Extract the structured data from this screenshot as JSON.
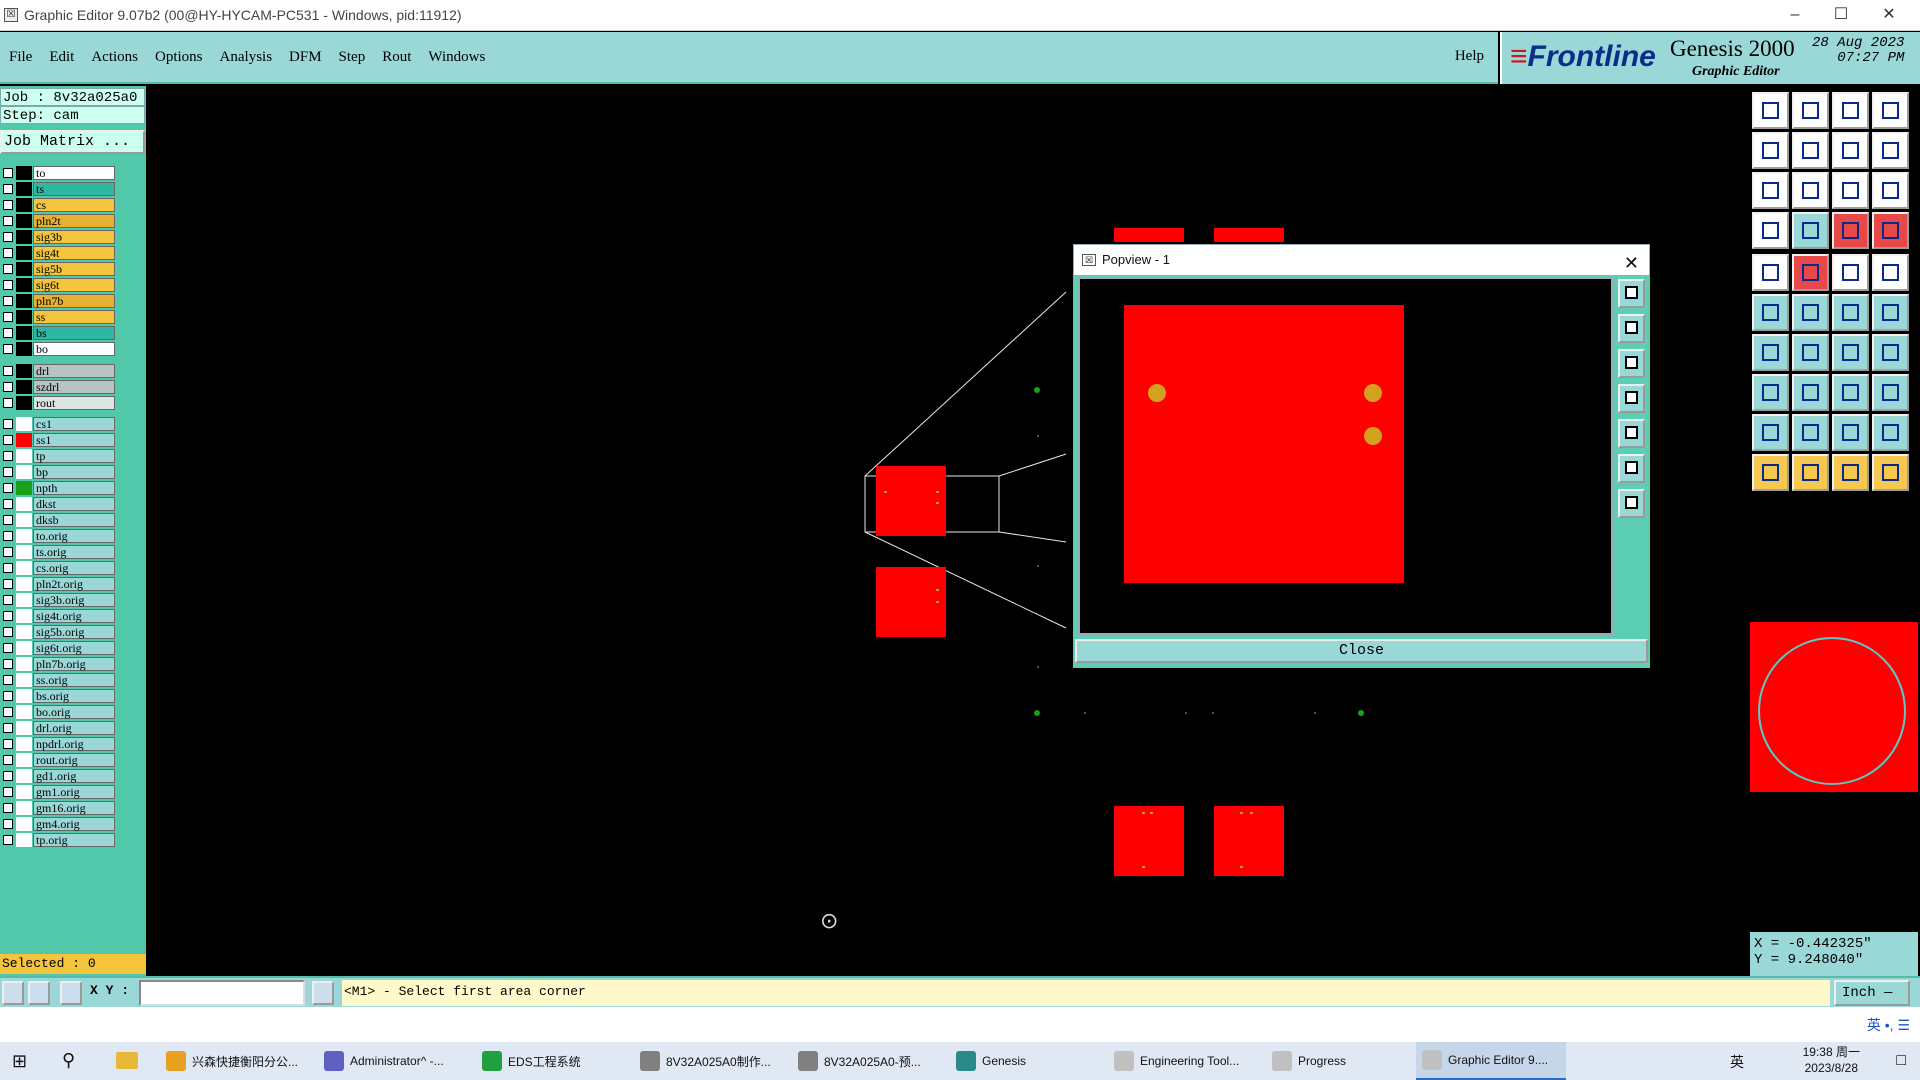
{
  "window": {
    "title": "Graphic Editor 9.07b2 (00@HY-HYCAM-PC531 - Windows, pid:11912)"
  },
  "window_controls": {
    "minimize": "–",
    "maximize": "☐",
    "close": "✕"
  },
  "menu": {
    "items": [
      "File",
      "Edit",
      "Actions",
      "Options",
      "Analysis",
      "DFM",
      "Step",
      "Rout",
      "Windows"
    ],
    "help": "Help"
  },
  "brand": {
    "logo_prefix": "Frontline",
    "product": "Genesis 2000",
    "subtitle": "Graphic Editor",
    "date": "28 Aug 2023",
    "time": "07:27 PM"
  },
  "job": {
    "job_line": "Job : 8v32a025a0",
    "step_line": "Step: cam",
    "matrix_button": "Job Matrix ..."
  },
  "layers_board": [
    {
      "name": "to",
      "color": "#ffffff"
    },
    {
      "name": "ts",
      "color": "#2eb8a0"
    },
    {
      "name": "cs",
      "color": "#f4c43c"
    },
    {
      "name": "pln2t",
      "color": "#e8b030"
    },
    {
      "name": "sig3b",
      "color": "#f4c43c"
    },
    {
      "name": "sig4t",
      "color": "#f4c43c"
    },
    {
      "name": "sig5b",
      "color": "#f4c43c"
    },
    {
      "name": "sig6t",
      "color": "#f4c43c"
    },
    {
      "name": "pln7b",
      "color": "#e8b030"
    },
    {
      "name": "ss",
      "color": "#f4c43c"
    },
    {
      "name": "bs",
      "color": "#2eb8a0"
    },
    {
      "name": "bo",
      "color": "#ffffff"
    }
  ],
  "layers_drill": [
    {
      "name": "drl",
      "color": "#b8c4c4"
    },
    {
      "name": "szdrl",
      "color": "#b8c4c4"
    },
    {
      "name": "rout",
      "color": "#dde4e4"
    }
  ],
  "layers_misc": [
    {
      "name": "cs1",
      "sw": "#ffffff"
    },
    {
      "name": "ss1",
      "sw": "#ff0000"
    },
    {
      "name": "tp",
      "sw": "#ffffff"
    },
    {
      "name": "bp",
      "sw": "#ffffff"
    },
    {
      "name": "npth",
      "sw": "#1aa01a"
    },
    {
      "name": "dkst",
      "sw": "#ffffff"
    },
    {
      "name": "dksb",
      "sw": "#ffffff"
    },
    {
      "name": "to.orig",
      "sw": "#ffffff"
    },
    {
      "name": "ts.orig",
      "sw": "#ffffff"
    },
    {
      "name": "cs.orig",
      "sw": "#ffffff"
    },
    {
      "name": "pln2t.orig",
      "sw": "#ffffff"
    },
    {
      "name": "sig3b.orig",
      "sw": "#ffffff"
    },
    {
      "name": "sig4t.orig",
      "sw": "#ffffff"
    },
    {
      "name": "sig5b.orig",
      "sw": "#ffffff"
    },
    {
      "name": "sig6t.orig",
      "sw": "#ffffff"
    },
    {
      "name": "pln7b.orig",
      "sw": "#ffffff"
    },
    {
      "name": "ss.orig",
      "sw": "#ffffff"
    },
    {
      "name": "bs.orig",
      "sw": "#ffffff"
    },
    {
      "name": "bo.orig",
      "sw": "#ffffff"
    },
    {
      "name": "drl.orig",
      "sw": "#ffffff"
    },
    {
      "name": "npdrl.orig",
      "sw": "#ffffff"
    },
    {
      "name": "rout.orig",
      "sw": "#ffffff"
    },
    {
      "name": "gd1.orig",
      "sw": "#ffffff"
    },
    {
      "name": "gm1.orig",
      "sw": "#ffffff"
    },
    {
      "name": "gm16.orig",
      "sw": "#ffffff"
    },
    {
      "name": "gm4.orig",
      "sw": "#ffffff"
    },
    {
      "name": "tp.orig",
      "sw": "#ffffff"
    }
  ],
  "selected": "Selected : 0",
  "popview": {
    "title": "Popview - 1",
    "close_label": "Close"
  },
  "coords": {
    "x": "X = -0.442325\"",
    "y": "Y = 9.248040\""
  },
  "bottom": {
    "xy_label": "X Y :",
    "message": "<M1> - Select first area corner",
    "units": "Inch —"
  },
  "ime": "英 •, ☰",
  "taskbar": {
    "items": [
      {
        "label": "兴森快捷衡阳分公...",
        "color": "#e8a020"
      },
      {
        "label": "Administrator^ -...",
        "color": "#6060c0"
      },
      {
        "label": "EDS工程系统",
        "color": "#20a040"
      },
      {
        "label": "8V32A025A0制作...",
        "color": "#808080"
      },
      {
        "label": "8V32A025A0-预...",
        "color": "#808080"
      },
      {
        "label": "Genesis",
        "color": "#2a8a8a"
      },
      {
        "label": "Engineering Tool...",
        "color": "#c0c0c0"
      },
      {
        "label": "Progress",
        "color": "#c0c0c0"
      },
      {
        "label": "Graphic Editor 9....",
        "color": "#c0c0c0"
      }
    ],
    "tray": "英",
    "clock_time": "19:38 周一",
    "clock_date": "2023/8/28"
  }
}
